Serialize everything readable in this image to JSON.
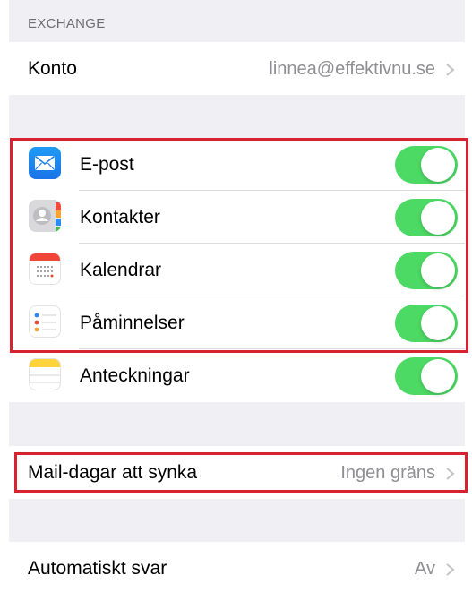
{
  "section": {
    "header": "EXCHANGE"
  },
  "account": {
    "label": "Konto",
    "value": "linnea@effektivnu.se"
  },
  "sync_items": [
    {
      "label": "E-post",
      "icon": "mail-icon",
      "on": true
    },
    {
      "label": "Kontakter",
      "icon": "contacts-icon",
      "on": true
    },
    {
      "label": "Kalendrar",
      "icon": "calendar-icon",
      "on": true
    },
    {
      "label": "Påminnelser",
      "icon": "reminders-icon",
      "on": true
    },
    {
      "label": "Anteckningar",
      "icon": "notes-icon",
      "on": true
    }
  ],
  "mail_days": {
    "label": "Mail-dagar att synka",
    "value": "Ingen gräns"
  },
  "auto_reply": {
    "label": "Automatiskt svar",
    "value": "Av"
  },
  "colors": {
    "toggle_on": "#4cd964",
    "highlight": "#d6232f",
    "secondary_text": "#8e8e93",
    "group_background": "#efeff4"
  }
}
